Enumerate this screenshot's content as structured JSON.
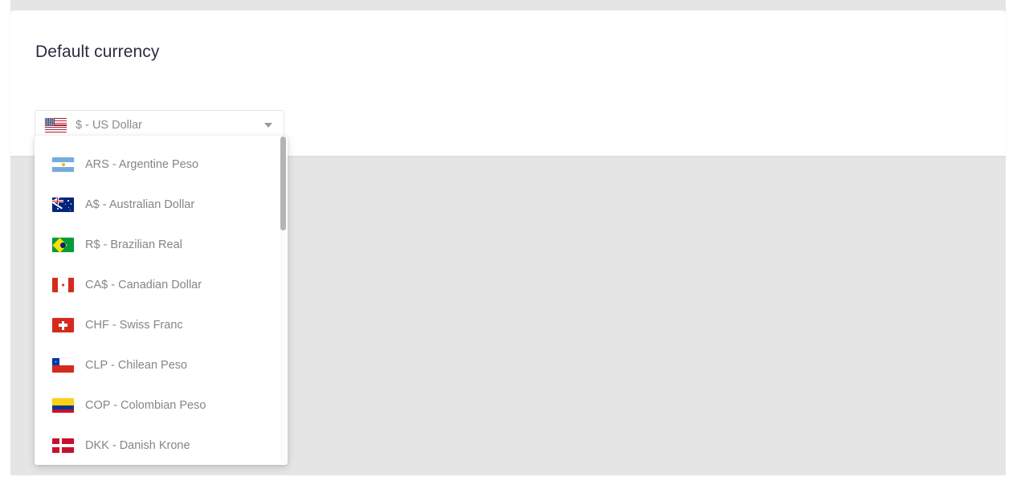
{
  "colors": {
    "page_background": "#e5e5e5",
    "card_background": "#ffffff",
    "title_text": "#2b2d42",
    "muted_text": "#858585",
    "scrollbar_thumb": "#b4b4b4"
  },
  "card": {
    "title": "Default currency"
  },
  "select": {
    "name": "default-currency-select",
    "selected_value": "$ - US Dollar",
    "selected_flag": "us-flag-icon",
    "caret_icon": "chevron-down-icon",
    "expanded": true
  },
  "dropdown": {
    "scroll_position": "top",
    "options": [
      {
        "label": "ARS - Argentine Peso",
        "flag": "ar-flag-icon",
        "code": "ARS"
      },
      {
        "label": "A$ - Australian Dollar",
        "flag": "au-flag-icon",
        "code": "AUD"
      },
      {
        "label": "R$ - Brazilian Real",
        "flag": "br-flag-icon",
        "code": "BRL"
      },
      {
        "label": "CA$ - Canadian Dollar",
        "flag": "ca-flag-icon",
        "code": "CAD"
      },
      {
        "label": "CHF - Swiss Franc",
        "flag": "ch-flag-icon",
        "code": "CHF"
      },
      {
        "label": "CLP - Chilean Peso",
        "flag": "cl-flag-icon",
        "code": "CLP"
      },
      {
        "label": "COP - Colombian Peso",
        "flag": "co-flag-icon",
        "code": "COP"
      },
      {
        "label": "DKK - Danish Krone",
        "flag": "dk-flag-icon",
        "code": "DKK"
      }
    ]
  }
}
